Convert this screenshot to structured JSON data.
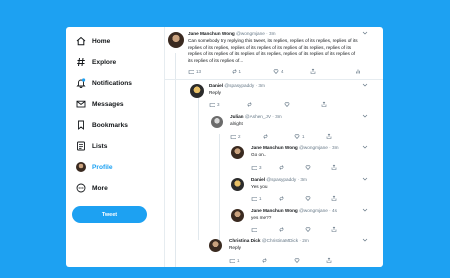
{
  "sidebar": {
    "items": [
      {
        "label": "Home",
        "icon": "home-icon"
      },
      {
        "label": "Explore",
        "icon": "hashtag-icon"
      },
      {
        "label": "Notifications",
        "icon": "bell-icon"
      },
      {
        "label": "Messages",
        "icon": "mail-icon"
      },
      {
        "label": "Bookmarks",
        "icon": "bookmark-icon"
      },
      {
        "label": "Lists",
        "icon": "list-icon"
      },
      {
        "label": "Profile",
        "icon": "avatar"
      },
      {
        "label": "More",
        "icon": "more-icon"
      }
    ],
    "active": "Profile",
    "tweet_button": "Tweet"
  },
  "colors": {
    "accent": "#1da1f2",
    "text": "#14171a",
    "muted": "#657786"
  },
  "tweets": [
    {
      "name": "Jane Manchun Wong",
      "meta": "@wongmjane · 3m",
      "text": "Can somebody try replying this tweet, its replies, replies of its replies, replies of its replies of its replies, replies of its replies of its replies of its replies, replies of its replies of its replies of its replies of its replies, replies of its replies of its replies of its replies of its replies of...",
      "replies": "13",
      "retweets": "1",
      "likes": "4"
    },
    {
      "name": "Daniel",
      "meta": "@spasypaddy · 3m",
      "text": "Reply",
      "replies": "3",
      "retweets": "",
      "likes": ""
    },
    {
      "name": "Julian",
      "meta": "@Ashen_JV · 3m",
      "text": "alright",
      "replies": "2",
      "retweets": "",
      "likes": "1"
    },
    {
      "name": "Jane Manchun Wong",
      "meta": "@wongmjane · 3m",
      "text": "Go on..",
      "replies": "3",
      "retweets": "",
      "likes": ""
    },
    {
      "name": "Daniel",
      "meta": "@spasypaddy · 3m",
      "text": "Yes you",
      "replies": "1",
      "retweets": "",
      "likes": ""
    },
    {
      "name": "Jane Manchun Wong",
      "meta": "@wongmjane · 4s",
      "text": "yes me??",
      "replies": "",
      "retweets": "",
      "likes": ""
    },
    {
      "name": "Christina Dick",
      "meta": "@ChristinaMDick · 2m",
      "text": "Reply",
      "replies": "1",
      "retweets": "",
      "likes": ""
    }
  ]
}
